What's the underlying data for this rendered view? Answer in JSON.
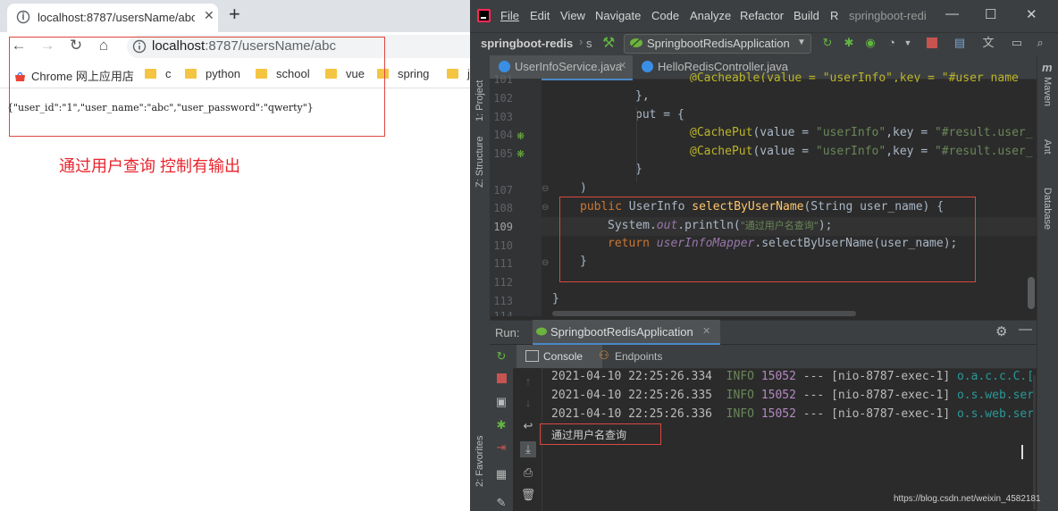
{
  "browser": {
    "tab_title": "localhost:8787/usersName/abc",
    "tab_close": "✕",
    "new_tab": "+",
    "nav": {
      "back": "←",
      "forward": "→",
      "reload": "↻",
      "home": "⌂"
    },
    "url_host": "localhost",
    "url_path": ":8787/usersName/abc",
    "bookmarks": [
      "Chrome 网上应用店",
      "c",
      "python",
      "school",
      "vue",
      "spring",
      "j"
    ],
    "response_json": "{\"user_id\":\"1\",\"user_name\":\"abc\",\"user_password\":\"qwerty\"}",
    "annotation": "通过用户查询 控制有输出"
  },
  "ide": {
    "menu": [
      "File",
      "Edit",
      "View",
      "Navigate",
      "Code",
      "Analyze",
      "Refactor",
      "Build",
      "R"
    ],
    "window_title": "springboot-redi",
    "window_controls": {
      "minimize": "—",
      "maximize": "☐",
      "close": "✕"
    },
    "project_name": "springboot-redis",
    "crumb_sep": "s",
    "run_config": "SpringbootRedisApplication",
    "left_tool_windows": {
      "project": "1: Project",
      "structure": "Z: Structure",
      "favorites": "2: Favorites"
    },
    "right_tool_windows": {
      "maven": "Maven",
      "ant": "Ant",
      "database": "Database"
    },
    "editor_tabs": [
      {
        "label": "UserInfoService.java",
        "active": true
      },
      {
        "label": "HelloRedisController.java",
        "active": false
      }
    ],
    "line_numbers": [
      "102",
      "103",
      "104",
      "105",
      "106",
      "107",
      "108",
      "109",
      "110",
      "111",
      "112",
      "113",
      "114"
    ],
    "code": {
      "l101": "@Cacheable(value = \"userInfo\",key = \"#user_name",
      "l102": "},",
      "l103_kw": "put",
      "l103_rest": " = {",
      "l104_ann": "@CachePut",
      "l104_mid": "(value = ",
      "l104_str": "\"userInfo\"",
      "l104_key": ",key = ",
      "l104_str2": "\"#result.user_",
      "l105_ann": "@CachePut",
      "l105_mid": "(value = ",
      "l105_str": "\"userInfo\"",
      "l105_key": ",key = ",
      "l105_str2": "\"#result.user_",
      "l106": "}",
      "l107": ")",
      "l108_kw": "public",
      "l108_type": " UserInfo ",
      "l108_fn": "selectByUserName",
      "l108_rest": "(String user_name) {",
      "l109_a": "System.",
      "l109_out": "out",
      "l109_b": ".println(",
      "l109_str": "\"通过用户名查询\"",
      "l109_c": ");",
      "l110_kw": "return",
      "l110_field": " userInfoMapper",
      "l110_rest": ".selectByUserName(user_name);",
      "l111": "}",
      "l113": "}"
    },
    "run": {
      "label": "Run:",
      "tab": "SpringbootRedisApplication",
      "console_tab": "Console",
      "endpoints_tab": "Endpoints",
      "logs": [
        {
          "time": "2021-04-10 22:25:26.334",
          "level": "INFO",
          "pid": "15052",
          "sep": " --- ",
          "thread": "[nio-8787-exec-1]",
          "logger": "o.a.c.c.C.["
        },
        {
          "time": "2021-04-10 22:25:26.335",
          "level": "INFO",
          "pid": "15052",
          "sep": " --- ",
          "thread": "[nio-8787-exec-1]",
          "logger": "o.s.web.ser"
        },
        {
          "time": "2021-04-10 22:25:26.336",
          "level": "INFO",
          "pid": "15052",
          "sep": " --- ",
          "thread": "[nio-8787-exec-1]",
          "logger": "o.s.web.ser"
        }
      ],
      "printed": "通过用户名查询"
    }
  },
  "watermark": "https://blog.csdn.net/weixin_4582181",
  "colors": {
    "annotation_red": "#e8242c",
    "ide_bg": "#2b2b2b",
    "keyword": "#cc7832",
    "string": "#6a8759"
  }
}
